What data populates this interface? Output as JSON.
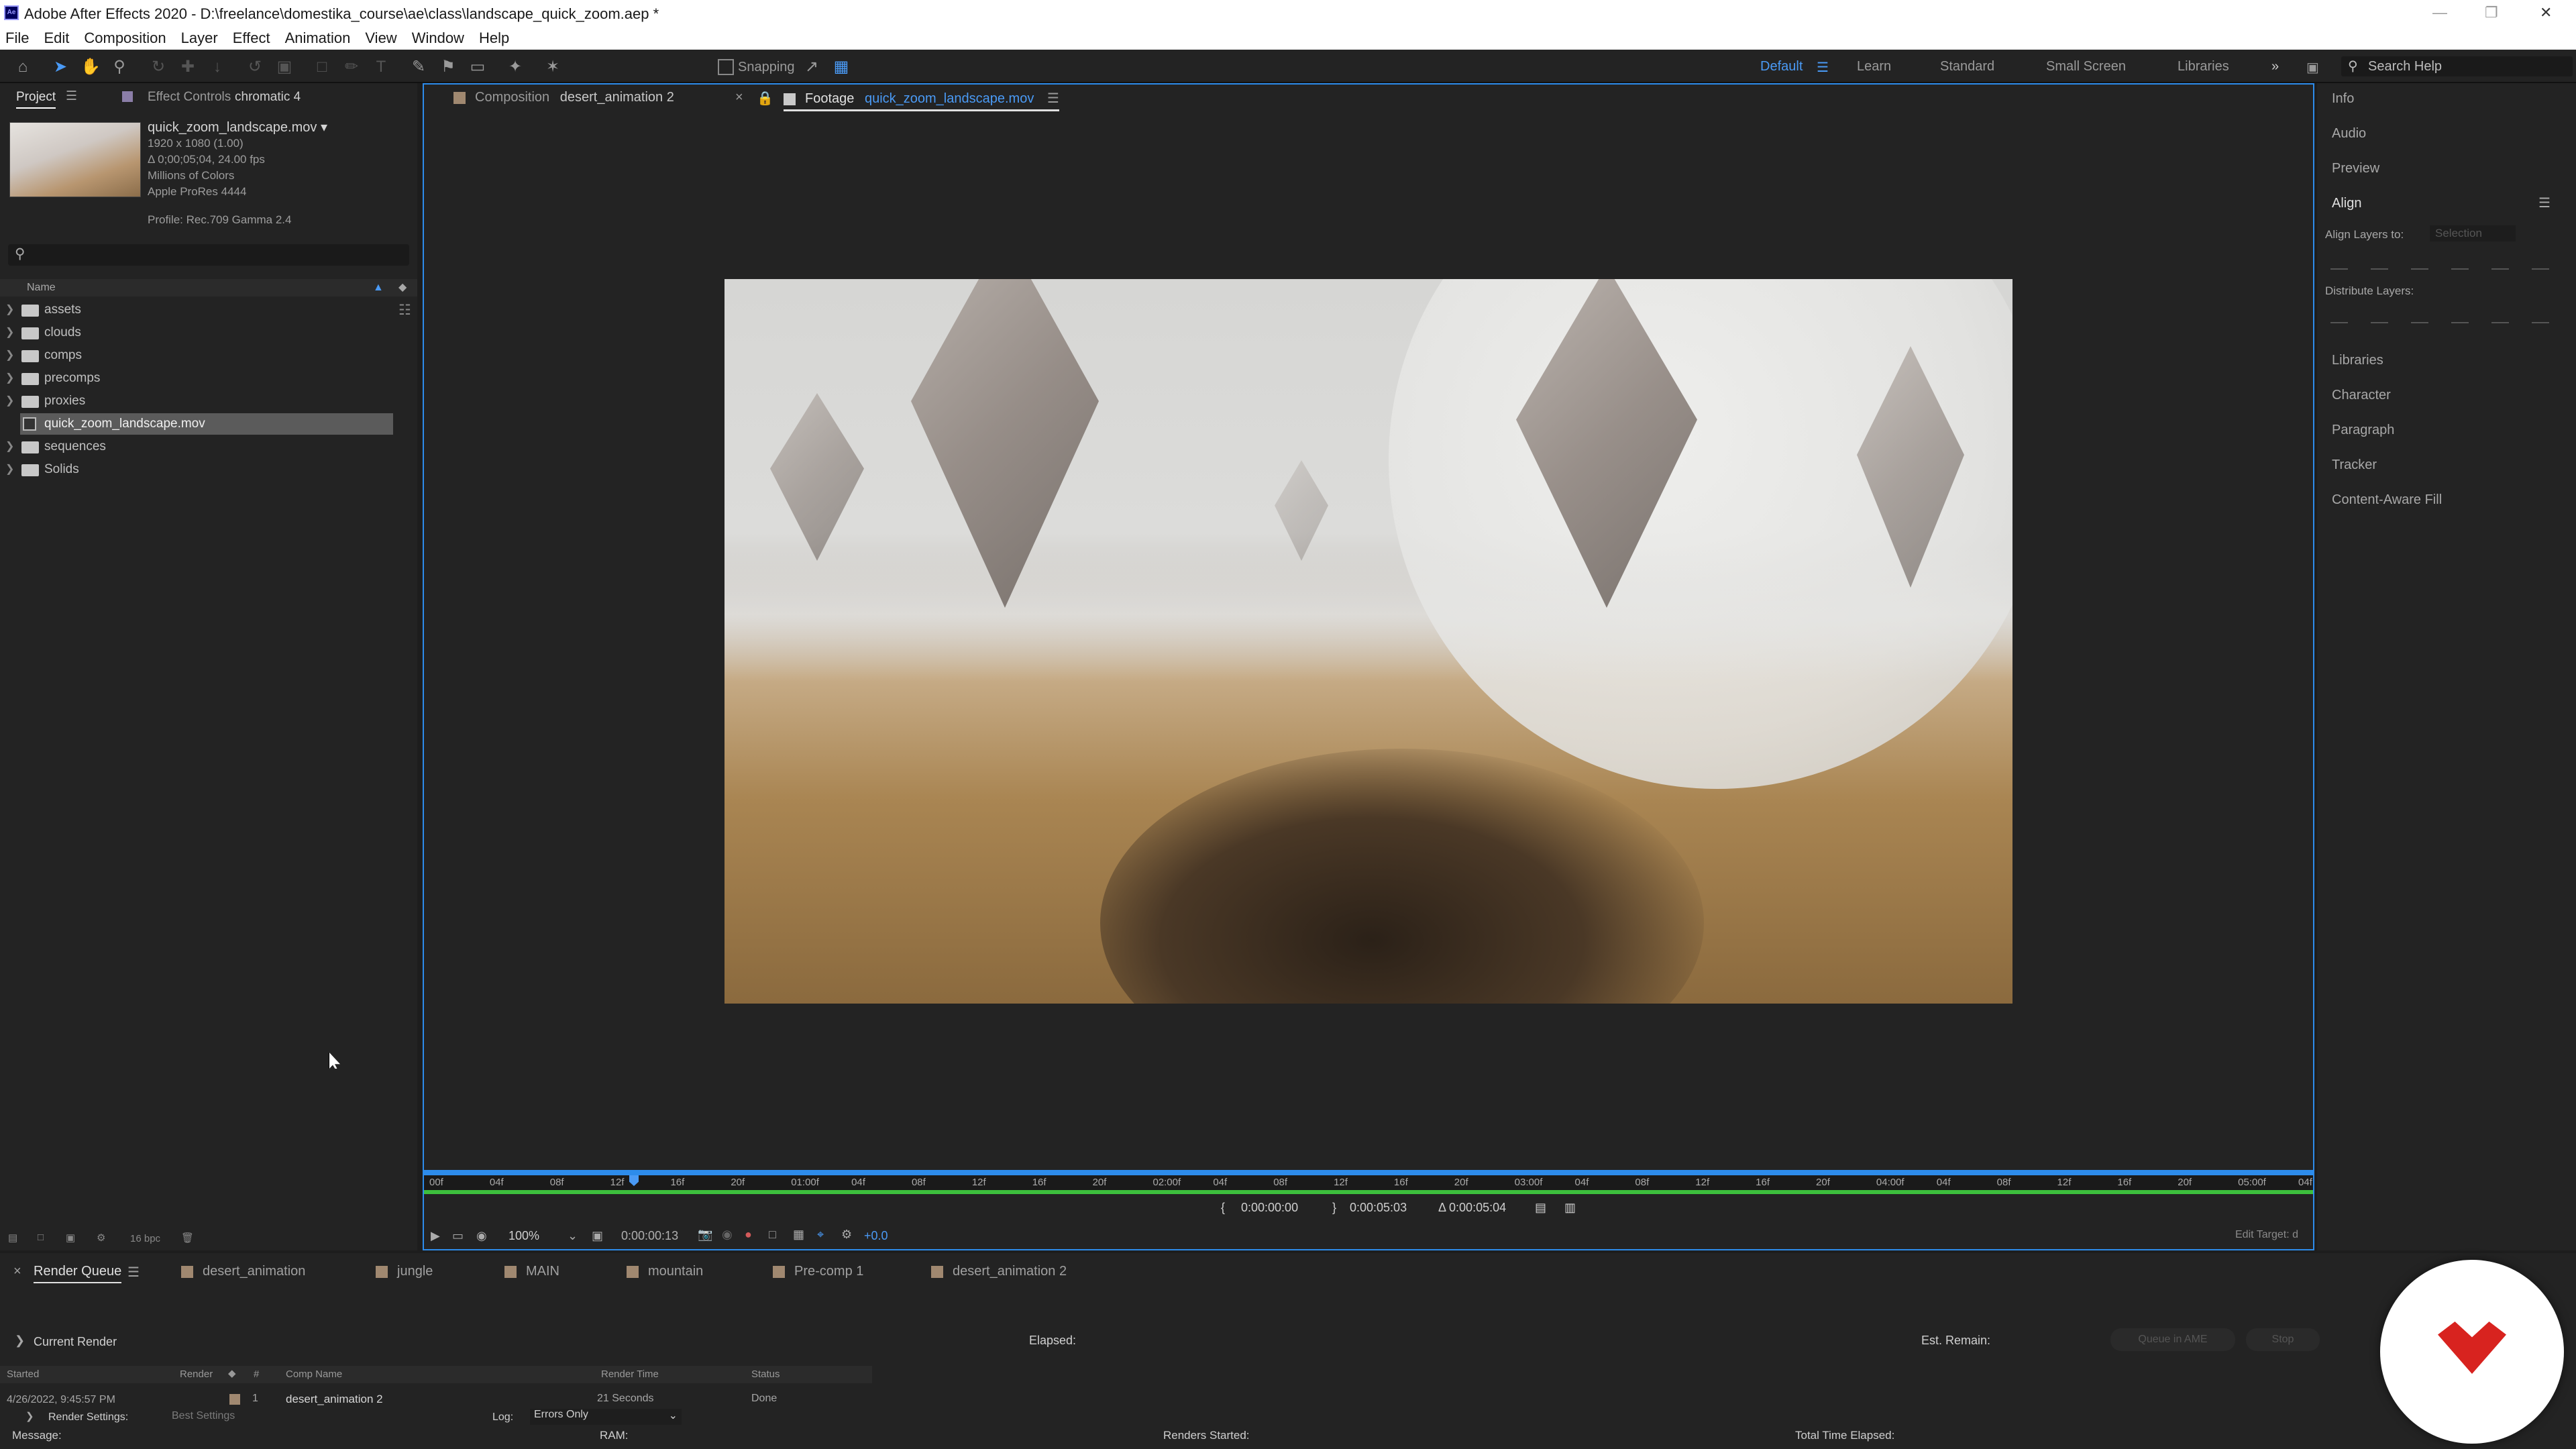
{
  "app": {
    "title": "Adobe After Effects 2020 - D:\\freelance\\domestika_course\\ae\\class\\landscape_quick_zoom.aep *",
    "icon_text": "Ae"
  },
  "menu": [
    "File",
    "Edit",
    "Composition",
    "Layer",
    "Effect",
    "Animation",
    "View",
    "Window",
    "Help"
  ],
  "toolbar": {
    "snapping_label": "Snapping",
    "workspaces": [
      "Default",
      "Learn",
      "Standard",
      "Small Screen",
      "Libraries"
    ],
    "search_help_placeholder": "Search Help"
  },
  "project_panel": {
    "tab_project": "Project",
    "tab_effect_controls": "Effect Controls",
    "effect_controls_target": "chromatic 4",
    "footage": {
      "name": "quick_zoom_landscape.mov",
      "dimensions": "1920 x 1080 (1.00)",
      "duration": "Δ 0;00;05;04, 24.00 fps",
      "colors": "Millions of Colors",
      "codec": "Apple ProRes 4444",
      "profile": "Profile: Rec.709 Gamma 2.4"
    },
    "column_name": "Name",
    "items": [
      {
        "label": "assets"
      },
      {
        "label": "clouds"
      },
      {
        "label": "comps"
      },
      {
        "label": "precomps"
      },
      {
        "label": "proxies"
      },
      {
        "label": "quick_zoom_landscape.mov",
        "selected": true
      },
      {
        "label": "sequences"
      },
      {
        "label": "Solids"
      }
    ],
    "bpc": "16 bpc"
  },
  "viewer": {
    "tab_composition_prefix": "Composition",
    "tab_composition_name": "desert_animation 2",
    "tab_footage_prefix": "Footage",
    "tab_footage_name": "quick_zoom_landscape.mov",
    "ruler_ticks": [
      "00f",
      "04f",
      "08f",
      "12f",
      "16f",
      "20f",
      "01:00f",
      "04f",
      "08f",
      "12f",
      "16f",
      "20f",
      "02:00f",
      "04f",
      "08f",
      "12f",
      "16f",
      "20f",
      "03:00f",
      "04f",
      "08f",
      "12f",
      "16f",
      "20f",
      "04:00f",
      "04f",
      "08f",
      "12f",
      "16f",
      "20f",
      "05:00f",
      "04f"
    ],
    "in_point": "0:00:00:00",
    "out_point": "0:00:05:03",
    "duration": "Δ 0:00:05:04",
    "zoom": "100%",
    "current_time": "0:00:00:13",
    "exposure": "+0.0",
    "edit_target": "Edit Target: d",
    "playhead_position": 0.11
  },
  "right_panel": {
    "items": [
      "Info",
      "Audio",
      "Preview",
      "Align",
      "Libraries",
      "Character",
      "Paragraph",
      "Tracker",
      "Content-Aware Fill"
    ],
    "align_layers_to": "Align Layers to:",
    "align_target": "Selection",
    "distribute_layers": "Distribute Layers:"
  },
  "render_queue": {
    "tabs": [
      "Render Queue",
      "desert_animation",
      "jungle",
      "MAIN",
      "mountain",
      "Pre-comp 1",
      "desert_animation 2"
    ],
    "current_render": "Current Render",
    "elapsed": "Elapsed:",
    "est_remain": "Est. Remain:",
    "queue_in_ame": "Queue in AME",
    "stop": "Stop",
    "headers": [
      "Started",
      "Render",
      "#",
      "Comp Name",
      "Render Time",
      "Status"
    ],
    "row": {
      "started": "4/26/2022, 9:45:57 PM",
      "number": "1",
      "comp_name": "desert_animation 2",
      "render_time": "21 Seconds",
      "status": "Done"
    },
    "render_settings_label": "Render Settings:",
    "render_settings_value": "Best Settings",
    "log_label": "Log:",
    "log_value": "Errors Only",
    "message": "Message:",
    "ram": "RAM:",
    "renders_started": "Renders Started:",
    "total_time_elapsed": "Total Time Elapsed:"
  },
  "colors": {
    "accent_blue": "#2d8ceb",
    "work_area_green": "#3dbf3d",
    "logo_red": "#d8231f"
  }
}
